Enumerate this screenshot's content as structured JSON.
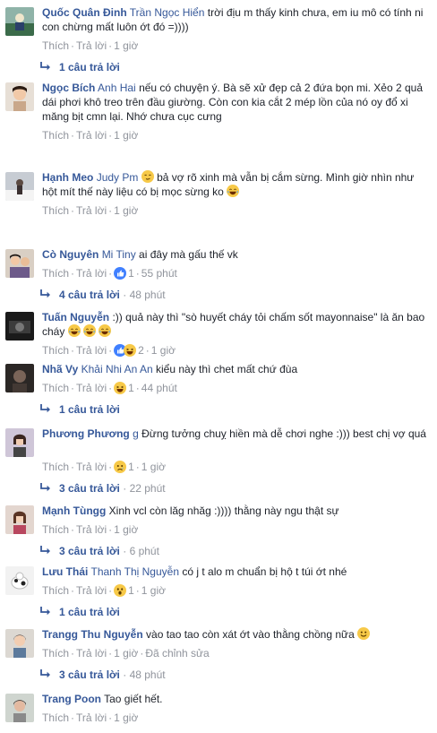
{
  "labels": {
    "like": "Thích",
    "reply": "Trả lời",
    "sep": "·"
  },
  "comments": [
    {
      "author": "Quốc Quân Đinh",
      "tag": "Trần Ngọc Hiển",
      "text": "trời địu m thấy kinh chưa, em iu mô có tính ni con chừng mất luôn ớt đó =))))",
      "time": "1 giờ",
      "replies_label": "1 câu trả lời",
      "replies_time": ""
    },
    {
      "author": "Ngọc Bích",
      "tag": "Anh Hai",
      "text": "nếu có chuyện ý. Bà sẽ xử đẹp cả 2 đứa bọn mi. Xẻo 2 quả dái phơi khô treo trên đầu giường. Còn con kia cắt 2 mép lồn của nó oy đổ xi măng bịt cmn lại. Nhớ chưa cục cưng",
      "time": "1 giờ",
      "replies_label": "",
      "replies_time": ""
    },
    {
      "author": "Hạnh Meo",
      "tag": "Judy Pm",
      "text": "bả vợ rõ xinh mà vẫn bị cắm sừng. Mình giờ nhìn như hột mít thế này liệu có bị mọc sừng ko",
      "time": "1 giờ",
      "replies_label": "",
      "replies_time": ""
    },
    {
      "author": "Cò Nguyên",
      "tag": "Mi Tiny",
      "text": "ai đây mà gấu thế vk",
      "time": "55 phút",
      "reaction_count": "1",
      "reaction": "like",
      "replies_label": "4 câu trả lời",
      "replies_time": "48 phút"
    },
    {
      "author": "Tuấn Nguyễn",
      "tag": "",
      "text": ":)) quả này thì \"sò huyết cháy tỏi chấm sốt mayonnaise\" là ăn bao cháy",
      "time": "1 giờ",
      "reaction_count": "2",
      "reaction": "like-haha",
      "replies_label": "",
      "replies_time": ""
    },
    {
      "author": "Nhã Vy",
      "tag": "Khải Nhi An An",
      "text": "kiểu này thì chet mất chứ đùa",
      "time": "44 phút",
      "reaction_count": "1",
      "reaction": "haha",
      "replies_label": "1 câu trả lời",
      "replies_time": ""
    },
    {
      "author": "Phương Phương",
      "tag": "g",
      "text": "Đừng tưởng chuỵ hiền mà dễ chơi nghe :))) best chị vợ quá",
      "time": "1 giờ",
      "reaction_count": "1",
      "reaction": "sad",
      "replies_label": "3 câu trả lời",
      "replies_time": "22 phút"
    },
    {
      "author": "Mạnh Tùngg",
      "tag": "",
      "text": "Xinh vcl còn lăg nhăg :)))) thằng này ngu thật sự",
      "time": "1 giờ",
      "replies_label": "3 câu trả lời",
      "replies_time": "6 phút"
    },
    {
      "author": "Lưu Thái",
      "tag": "Thanh Thị Nguyễn",
      "text": "có j t alo m chuẩn bị hộ t túi ớt nhé",
      "time": "1 giờ",
      "reaction_count": "1",
      "reaction": "wow",
      "replies_label": "1 câu trả lời",
      "replies_time": ""
    },
    {
      "author": "Trangg Thu Nguyễn",
      "tag": "",
      "text": "vào tao tao còn xát ớt vào thằng chồng nữa",
      "time": "1 giờ",
      "edited": "Đã chỉnh sửa",
      "replies_label": "3 câu trả lời",
      "replies_time": "48 phút"
    },
    {
      "author": "Trang Poon",
      "tag": "",
      "text": "Tao giết hết.",
      "time": "1 giờ",
      "replies_label": "",
      "replies_time": ""
    }
  ],
  "colors": {
    "link": "#365899",
    "meta": "#90949c",
    "text": "#1d2129",
    "like_blue": "#4080ff",
    "emoji_yellow": "#f7c948"
  }
}
